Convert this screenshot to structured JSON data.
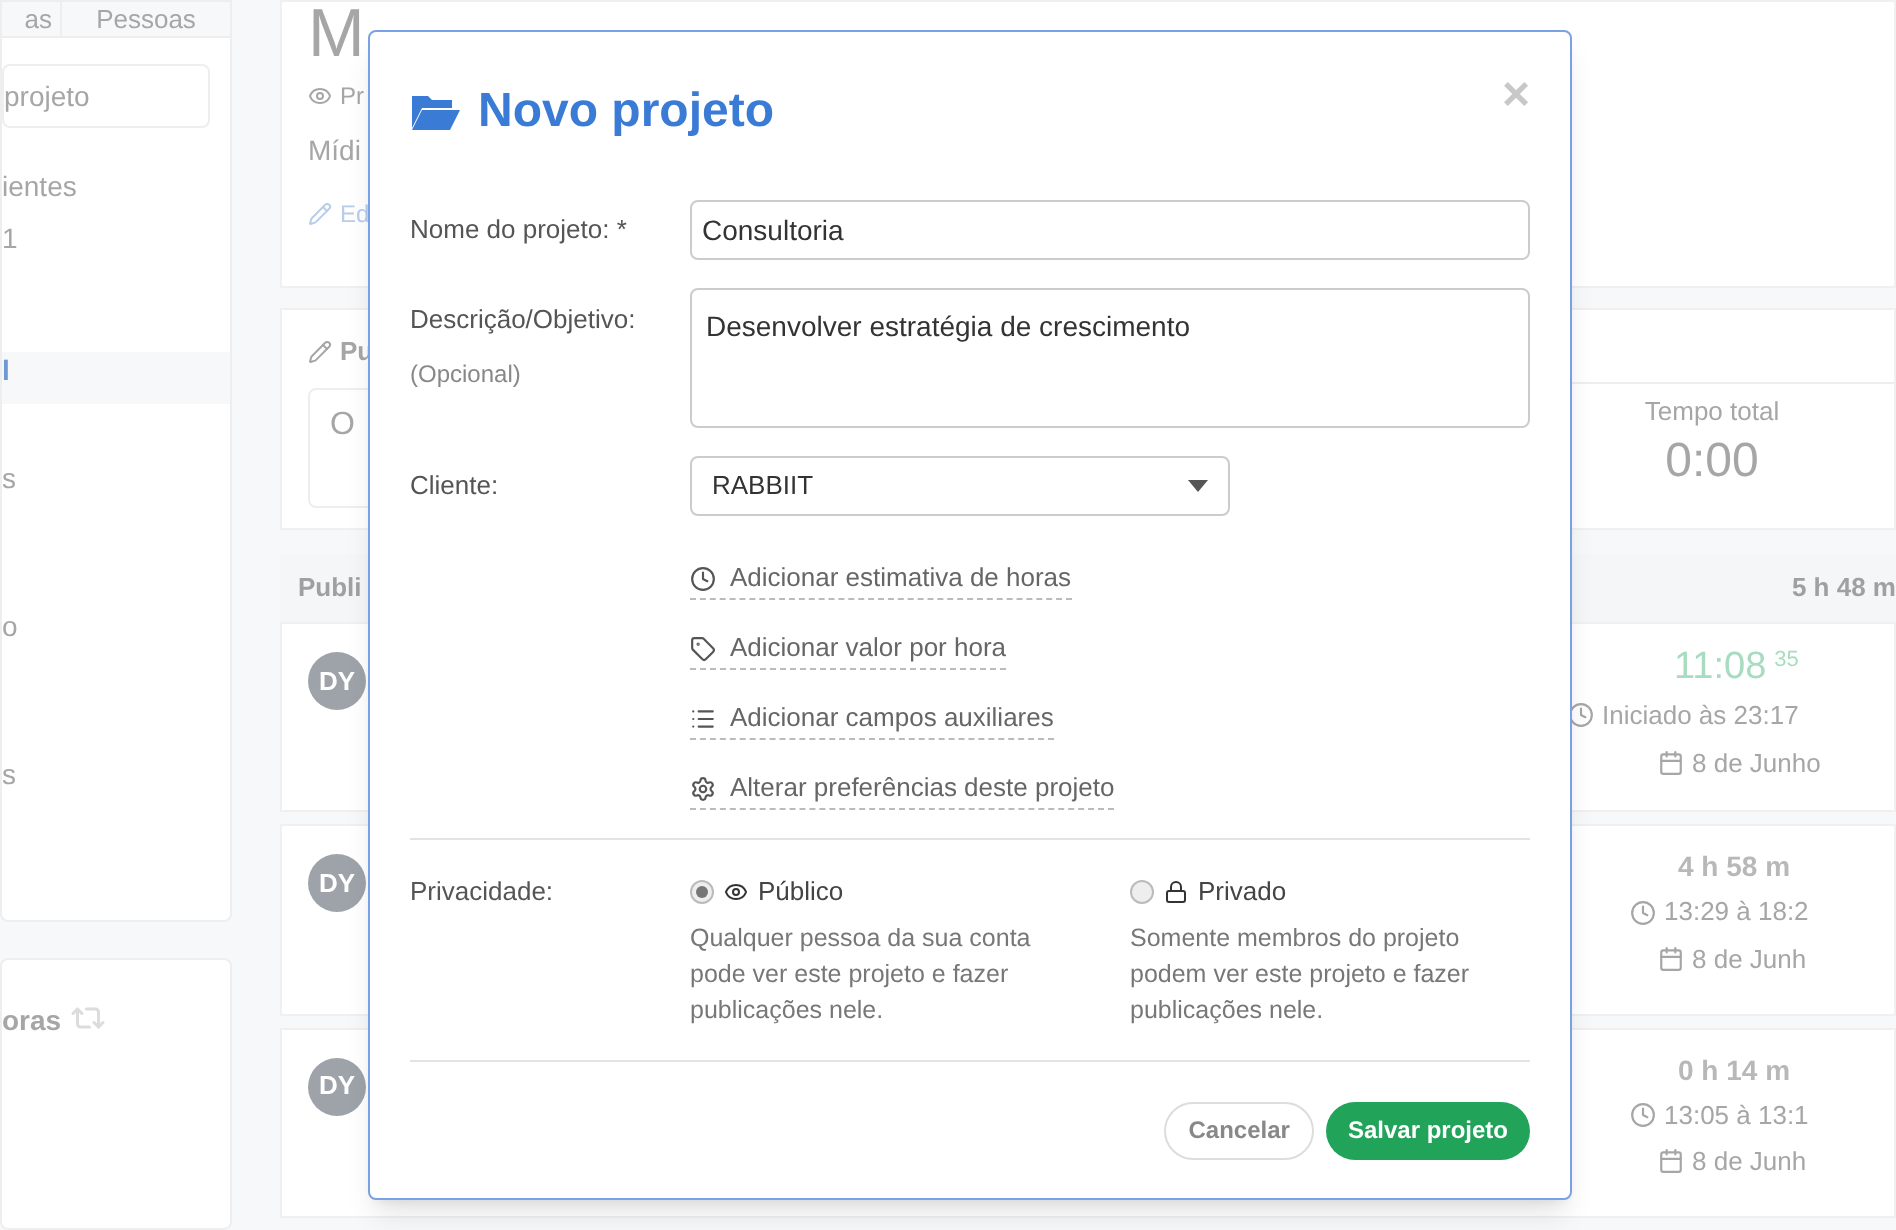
{
  "sidebar": {
    "tabs": [
      {
        "label": "as",
        "selected": false
      },
      {
        "label": "Pessoas",
        "selected": false
      }
    ],
    "search": {
      "placeholder": "projeto"
    },
    "items": [
      {
        "label": "ientes",
        "kind": "text"
      },
      {
        "label": "1",
        "kind": "text"
      },
      {
        "label": "l",
        "kind": "link"
      },
      {
        "label": "s",
        "kind": "text"
      },
      {
        "label": "o",
        "kind": "text"
      },
      {
        "label": "s",
        "kind": "text"
      }
    ],
    "second_card": {
      "title": "oras"
    }
  },
  "project": {
    "title": "M",
    "visibility": "Pr",
    "category": "Mídi",
    "edit_link": "Ed"
  },
  "composer": {
    "label": "Pu",
    "placeholder": "O",
    "total_label": "Tempo total",
    "total_value": "0:00"
  },
  "feed": {
    "heading": "Publi",
    "total": "5 h 48 m",
    "entries": [
      {
        "avatar": "DY",
        "running": true,
        "duration": "11:08",
        "seconds": "35",
        "time": "Iniciado às 23:17",
        "date": "8 de Junho"
      },
      {
        "avatar": "DY",
        "running": false,
        "duration": "4 h 58 m",
        "time": "13:29 à 18:2",
        "date": "8 de Junh"
      },
      {
        "avatar": "DY",
        "running": false,
        "duration": "0 h 14 m",
        "time": "13:05 à 13:1",
        "date": "8 de Junh"
      }
    ]
  },
  "dialog": {
    "title": "Novo projeto",
    "close": "×",
    "name": {
      "label": "Nome do projeto: *",
      "value": "Consultoria"
    },
    "description": {
      "label": "Descrição/Objetivo:",
      "hint": "(Opcional)",
      "value": "Desenvolver estratégia de crescimento"
    },
    "client": {
      "label": "Cliente:",
      "value": "RABBIIT"
    },
    "links": [
      {
        "label": "Adicionar estimativa de horas",
        "kind": "clock"
      },
      {
        "label": "Adicionar valor por hora",
        "kind": "tag"
      },
      {
        "label": "Adicionar campos auxiliares",
        "kind": "list"
      },
      {
        "label": "Alterar preferências deste projeto",
        "kind": "gear"
      }
    ],
    "privacy": {
      "label": "Privacidade:",
      "options": [
        {
          "label": "Público",
          "kind": "eye",
          "selected": true,
          "description": "Qualquer pessoa da sua conta pode ver este projeto e fazer publicações nele."
        },
        {
          "label": "Privado",
          "kind": "lock",
          "selected": false,
          "description": "Somente membros do projeto podem ver este projeto e fazer publicações nele."
        }
      ]
    },
    "buttons": {
      "cancel": "Cancelar",
      "save": "Salvar projeto"
    }
  }
}
